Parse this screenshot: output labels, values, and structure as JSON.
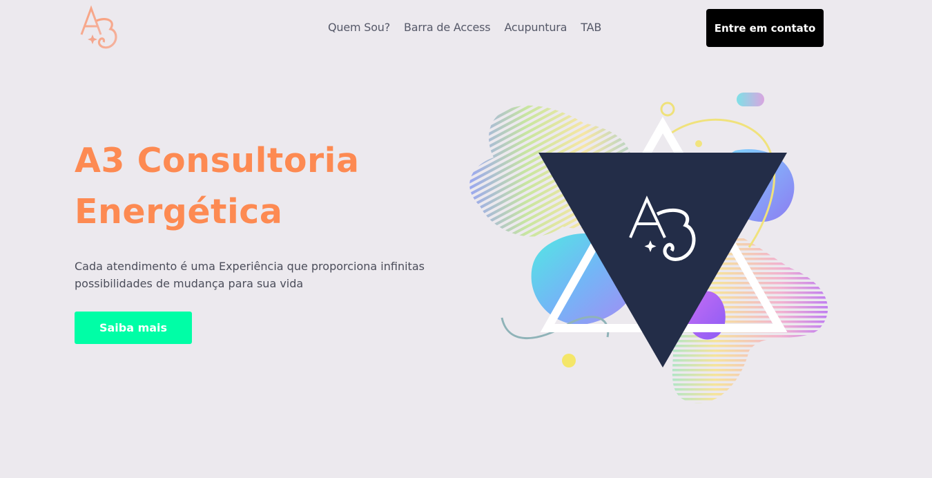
{
  "brand": {
    "logo_text": "A3",
    "accent_color": "#fd8a52",
    "cta_color": "#00fea6",
    "triangle_color": "#232d48"
  },
  "nav": {
    "items": [
      {
        "label": "Quem Sou?"
      },
      {
        "label": "Barra de Access"
      },
      {
        "label": "Acupuntura"
      },
      {
        "label": "TAB"
      }
    ],
    "contact_label": "Entre em contato"
  },
  "hero": {
    "title_line1": "A3 Consultoria",
    "title_line2": "Energética",
    "subtitle": "Cada atendimento é uma Experiência que proporciona infinitas possibilidades de mudança para sua vida",
    "button_label": "Saiba mais"
  },
  "illustration": {
    "monogram": "A3"
  }
}
